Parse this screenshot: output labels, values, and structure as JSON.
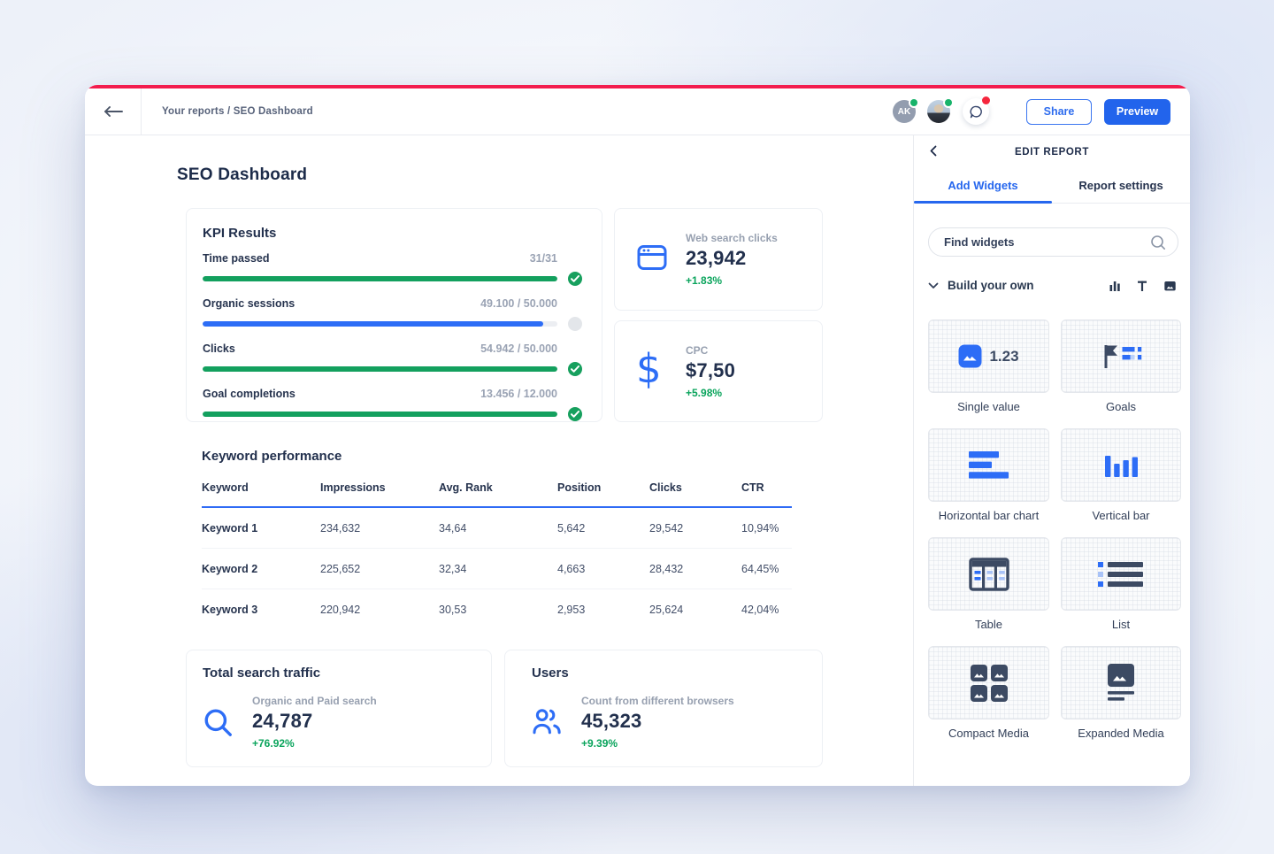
{
  "colors": {
    "green": "#13A05E",
    "blue": "#2D6DF6",
    "red": "#F31D4E",
    "accent_blue": "#2667EE"
  },
  "topbar": {
    "breadcrumb": "Your reports / SEO Dashboard",
    "avatar_initials": "AK",
    "share_label": "Share",
    "preview_label": "Preview"
  },
  "report": {
    "title": "SEO Dashboard",
    "kpi": {
      "title": "KPI Results",
      "items": [
        {
          "label": "Time passed",
          "value": "31/31",
          "pct": 100,
          "color": "green",
          "status": "done"
        },
        {
          "label": "Organic sessions",
          "value": "49.100 / 50.000",
          "pct": 96,
          "color": "blue",
          "status": "pending"
        },
        {
          "label": "Clicks",
          "value": "54.942 / 50.000",
          "pct": 100,
          "color": "green",
          "status": "done"
        },
        {
          "label": "Goal completions",
          "value": "13.456 / 12.000",
          "pct": 100,
          "color": "green",
          "status": "done"
        }
      ]
    },
    "stats": [
      {
        "icon": "browser-icon",
        "label": "Web search clicks",
        "value": "23,942",
        "delta": "+1.83%"
      },
      {
        "icon": "dollar-icon",
        "label": "CPC",
        "value": "$7,50",
        "delta": "+5.98%"
      }
    ],
    "keyword_table": {
      "title": "Keyword performance",
      "columns": [
        "Keyword",
        "Impressions",
        "Avg. Rank",
        "Position",
        "Clicks",
        "CTR"
      ],
      "rows": [
        [
          "Keyword 1",
          "234,632",
          "34,64",
          "5,642",
          "29,542",
          "10,94%"
        ],
        [
          "Keyword 2",
          "225,652",
          "32,34",
          "4,663",
          "28,432",
          "64,45%"
        ],
        [
          "Keyword 3",
          "220,942",
          "30,53",
          "2,953",
          "25,624",
          "42,04%"
        ]
      ]
    },
    "bottom_stats": [
      {
        "title": "Total search traffic",
        "icon": "search-icon",
        "label": "Organic and Paid search",
        "value": "24,787",
        "delta": "+76.92%"
      },
      {
        "title": "Users",
        "icon": "users-icon",
        "label": "Count from different browsers",
        "value": "45,323",
        "delta": "+9.39%"
      }
    ]
  },
  "sidebar": {
    "title": "EDIT REPORT",
    "tabs": [
      {
        "label": "Add Widgets"
      },
      {
        "label": "Report settings"
      }
    ],
    "search_placeholder": "Find widgets",
    "section_label": "Build your own",
    "single_value_sample": "1.23",
    "widgets": [
      "Single value",
      "Goals",
      "Horizontal bar chart",
      "Vertical bar",
      "Table",
      "List",
      "Compact Media",
      "Expanded Media"
    ]
  }
}
